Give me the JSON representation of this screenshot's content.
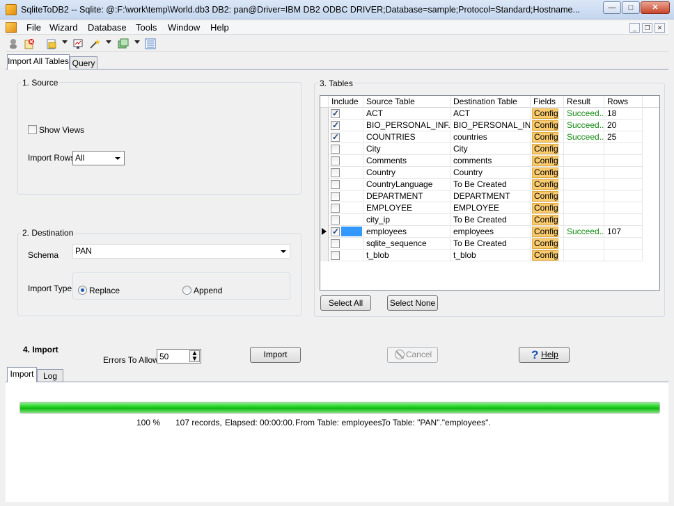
{
  "window": {
    "title": "SqliteToDB2 -- Sqlite: @:F:\\work\\temp\\World.db3 DB2: pan@Driver=IBM DB2 ODBC DRIVER;Database=sample;Protocol=Standard;Hostname...",
    "minimize": "—",
    "maximize": "□",
    "close": "✕"
  },
  "menu": [
    "File",
    "Wizard",
    "Database",
    "Tools",
    "Window",
    "Help"
  ],
  "mdi": {
    "minimize": "_",
    "restore": "❐",
    "close": "✕"
  },
  "tabs": [
    "Import All Tables",
    "Query"
  ],
  "source": {
    "title": "1. Source",
    "show_views": "Show Views",
    "import_rows_label": "Import Rows",
    "import_rows_value": "All"
  },
  "destination": {
    "title": "2. Destination",
    "schema_label": "Schema",
    "schema_value": "PAN",
    "import_type_label": "Import Type",
    "replace": "Replace",
    "append": "Append"
  },
  "tables": {
    "title": "3. Tables",
    "columns": [
      "Include",
      "Source Table",
      "Destination Table",
      "Fields",
      "Result",
      "Rows"
    ],
    "rows": [
      {
        "include": true,
        "source": "ACT",
        "dest": "ACT",
        "fields": "Config",
        "result": "Succeed...",
        "rows": "18"
      },
      {
        "include": true,
        "source": "BIO_PERSONAL_INF...",
        "dest": "BIO_PERSONAL_IN...",
        "fields": "Config",
        "result": "Succeed...",
        "rows": "20"
      },
      {
        "include": true,
        "source": "COUNTRIES",
        "dest": "countries",
        "fields": "Config",
        "result": "Succeed...",
        "rows": "25"
      },
      {
        "include": false,
        "source": "City",
        "dest": "City",
        "fields": "Config",
        "result": "",
        "rows": ""
      },
      {
        "include": false,
        "source": "Comments",
        "dest": "comments",
        "fields": "Config",
        "result": "",
        "rows": ""
      },
      {
        "include": false,
        "source": "Country",
        "dest": "Country",
        "fields": "Config",
        "result": "",
        "rows": ""
      },
      {
        "include": false,
        "source": "CountryLanguage",
        "dest": "To Be Created",
        "fields": "Config",
        "result": "",
        "rows": ""
      },
      {
        "include": false,
        "source": "DEPARTMENT",
        "dest": "DEPARTMENT",
        "fields": "Config",
        "result": "",
        "rows": ""
      },
      {
        "include": false,
        "source": "EMPLOYEE",
        "dest": "EMPLOYEE",
        "fields": "Config",
        "result": "",
        "rows": ""
      },
      {
        "include": false,
        "source": "city_ip",
        "dest": "To Be Created",
        "fields": "Config",
        "result": "",
        "rows": ""
      },
      {
        "include": true,
        "source": "employees",
        "dest": "employees",
        "fields": "Config",
        "result": "Succeed...",
        "rows": "107"
      },
      {
        "include": false,
        "source": "sqlite_sequence",
        "dest": "To Be Created",
        "fields": "Config",
        "result": "",
        "rows": ""
      },
      {
        "include": false,
        "source": "t_blob",
        "dest": "t_blob",
        "fields": "Config",
        "result": "",
        "rows": ""
      }
    ],
    "select_all": "Select All",
    "select_none": "Select None"
  },
  "import": {
    "title": "4. Import",
    "errors_label": "Errors To Allow",
    "errors_value": "50",
    "import_button": "Import",
    "cancel_button": "Cancel",
    "help_button": "Help"
  },
  "bottom_tabs": [
    "Import",
    "Log"
  ],
  "progress": {
    "fraction": 1.0,
    "percent": "100 %",
    "records": "107 records,",
    "elapsed": "Elapsed: 00:00:00.",
    "from_table": "From Table: employees,",
    "to_table": "To Table: \"PAN\".\"employees\"."
  },
  "colors": {
    "progress": "#1fcf1f",
    "config": "#f9cb6e",
    "succeeded": "#118a11"
  }
}
